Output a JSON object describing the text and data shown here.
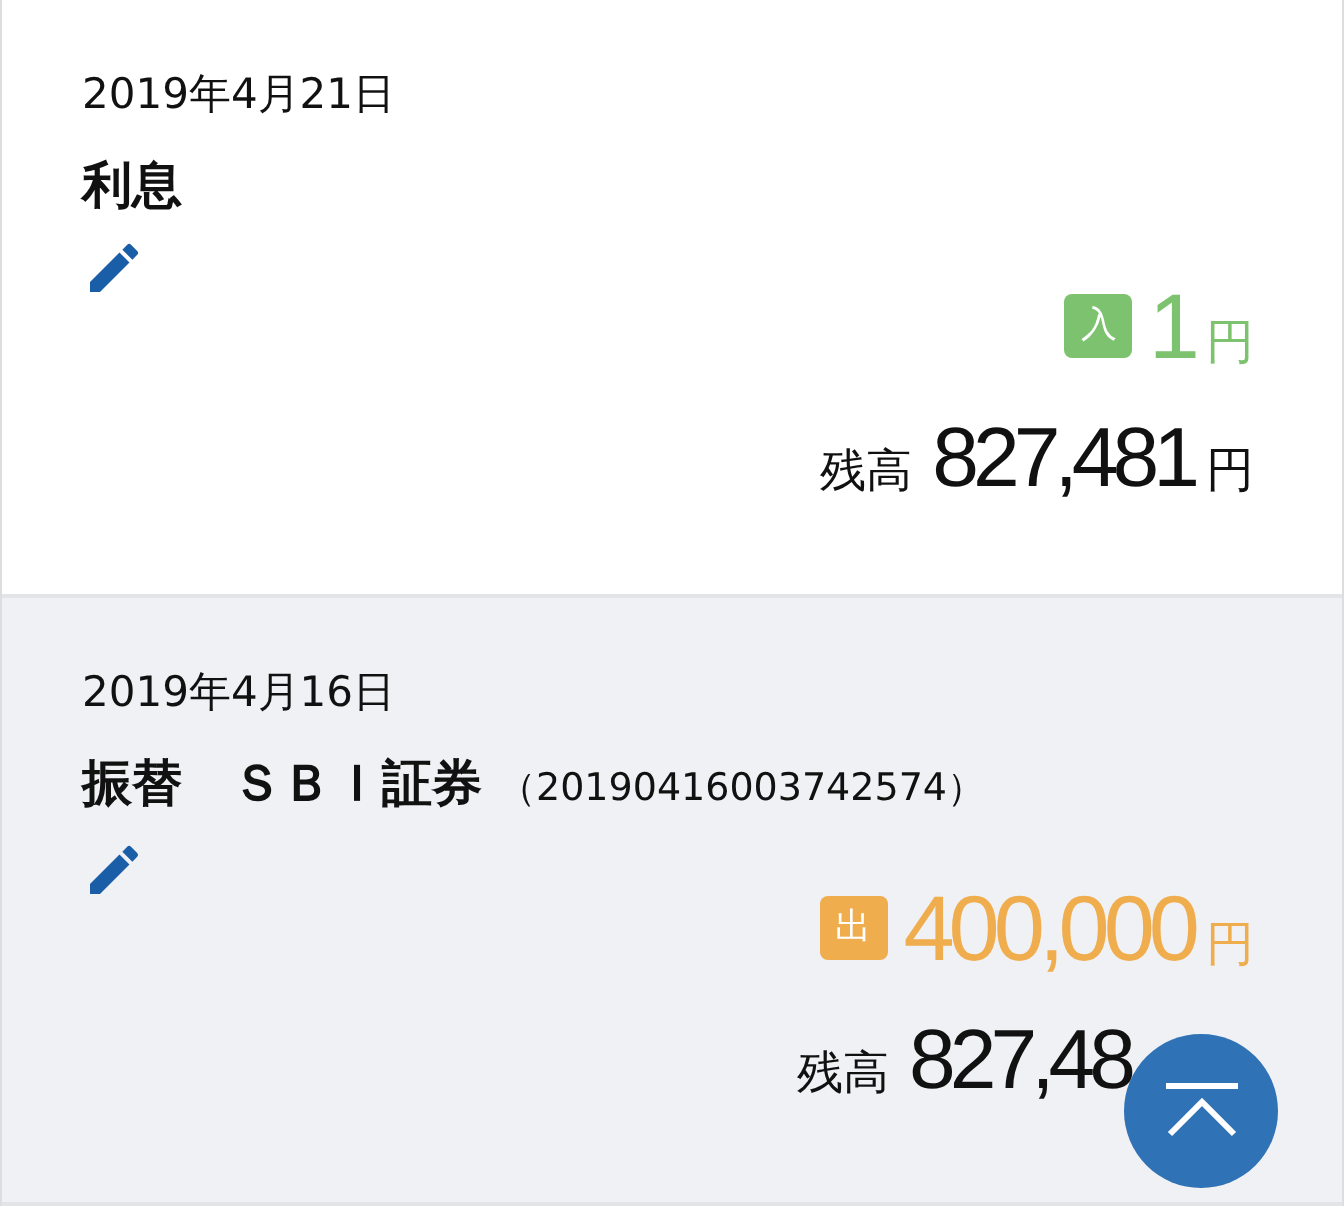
{
  "transactions": [
    {
      "date": "2019年4月21日",
      "title": "利息",
      "kind": "in",
      "badge": "入",
      "amount": "1",
      "amount_unit": "円",
      "balance_label": "残高",
      "balance": "827,481",
      "balance_unit": "円",
      "highlighted": false
    },
    {
      "date": "2019年4月16日",
      "title": "振替　ＳＢＩ証券",
      "reference": "（20190416003742574）",
      "kind": "out",
      "badge": "出",
      "amount": "400,000",
      "amount_unit": "円",
      "balance_label": "残高",
      "balance": "827,48",
      "highlighted": true
    }
  ]
}
